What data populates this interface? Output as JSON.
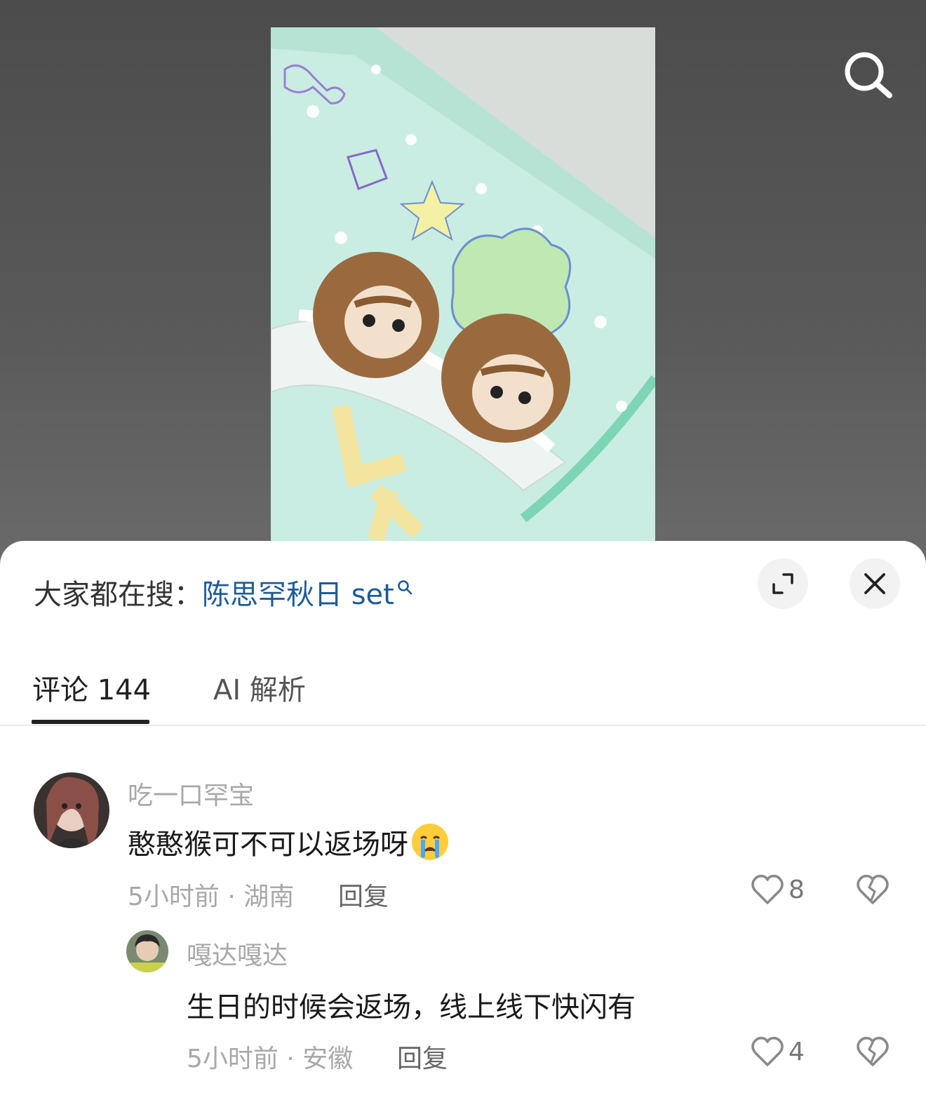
{
  "search_hint": {
    "prefix": "大家都在搜：",
    "query": "陈思罕秋日 set"
  },
  "tabs": [
    {
      "label": "评论 144",
      "active": true
    },
    {
      "label": "AI 解析",
      "active": false
    }
  ],
  "comments": [
    {
      "username": "吃一口罕宝",
      "text": "憨憨猴可不可以返场呀",
      "emoji": "crying-face-emoji",
      "time_location": "5小时前 · 湖南",
      "reply_label": "回复",
      "likes": "8"
    },
    {
      "username": "嘎达嘎达",
      "text": "生日的时候会返场，线上线下快闪有",
      "time_location": "5小时前 · 安徽",
      "reply_label": "回复",
      "likes": "4"
    }
  ],
  "icons": [
    "search-icon",
    "expand-icon",
    "close-icon",
    "heart-icon",
    "broken-heart-icon"
  ],
  "colors": {
    "link": "#1e5b96",
    "accent_text": "#222222",
    "muted_text": "#a8a8a8"
  }
}
